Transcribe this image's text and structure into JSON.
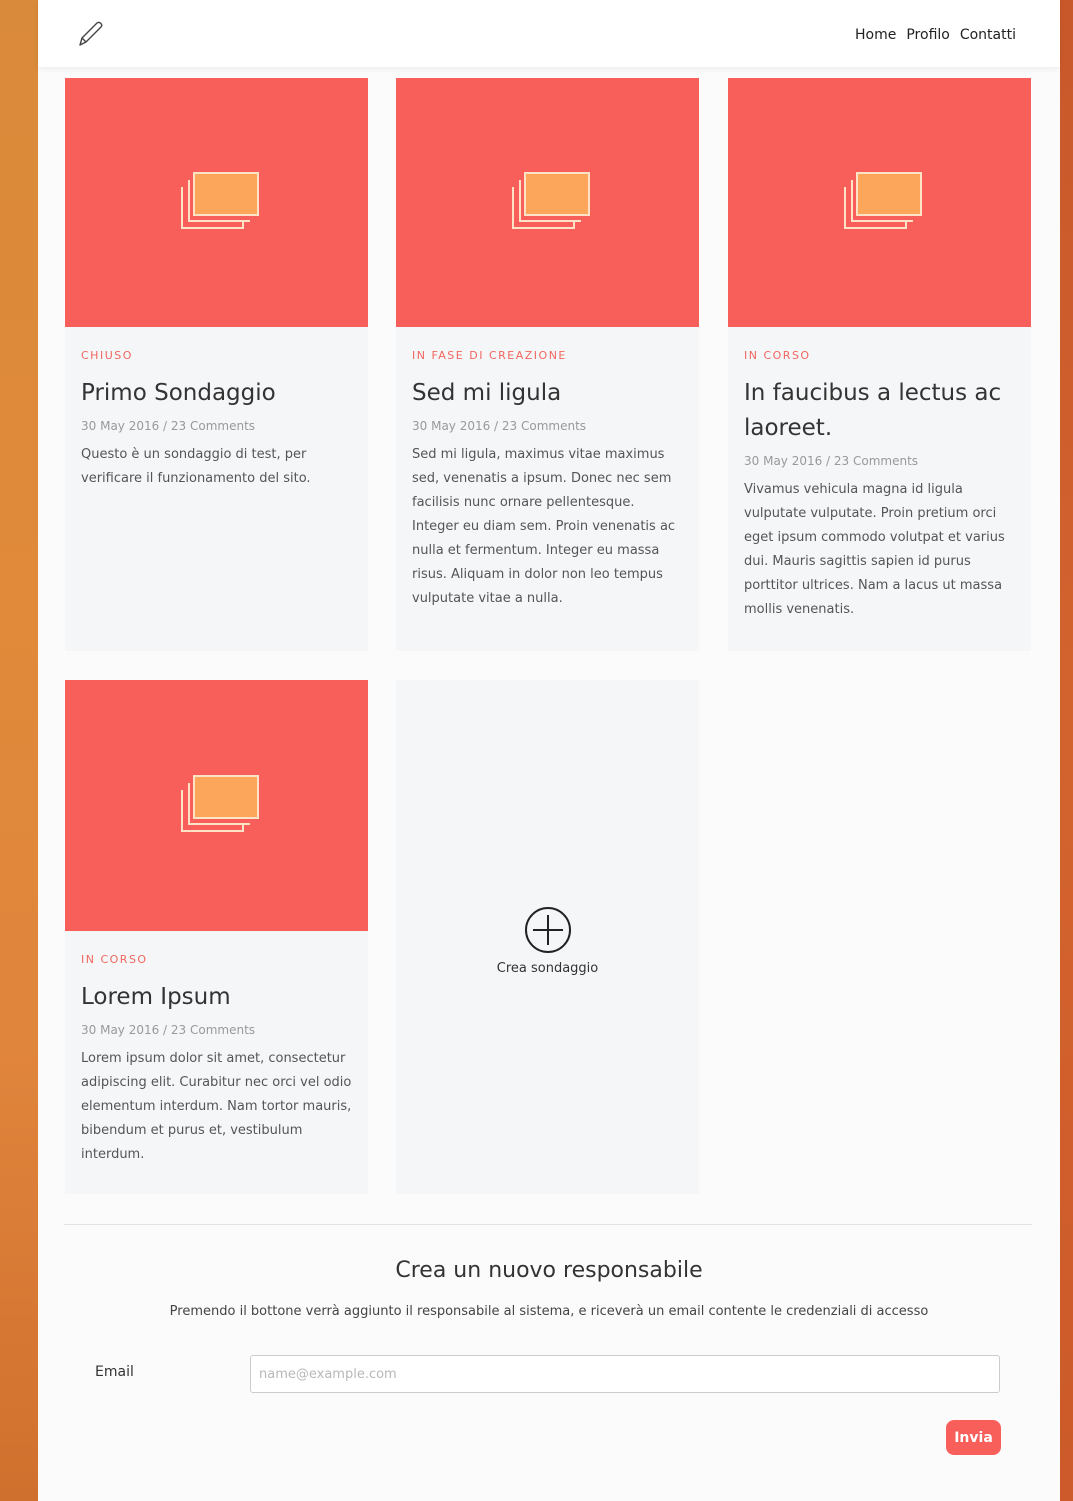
{
  "nav": {
    "logo_icon": "pencil-icon",
    "links": [
      "Home",
      "Profilo",
      "Contatti"
    ]
  },
  "colors": {
    "accent": "#f95f5a",
    "image_icon": "#fba65a"
  },
  "cards": [
    {
      "status": "CHIUSO",
      "title": "Primo Sondaggio",
      "meta": "30 May 2016 / 23 Comments",
      "description": "Questo è un sondaggio di test, per verificare il funzionamento del sito."
    },
    {
      "status": "IN FASE DI CREAZIONE",
      "title": "Sed mi ligula",
      "meta": "30 May 2016 / 23 Comments",
      "description": "Sed mi ligula, maximus vitae maximus sed, venenatis a ipsum. Donec nec sem facilisis nunc ornare pellentesque. Integer eu diam sem. Proin venenatis ac nulla et fermentum. Integer eu massa risus. Aliquam in dolor non leo tempus vulputate vitae a nulla."
    },
    {
      "status": "IN CORSO",
      "title": "In faucibus a lectus ac laoreet.",
      "meta": "30 May 2016 / 23 Comments",
      "description": "Vivamus vehicula magna id ligula vulputate vulputate. Proin pretium orci eget ipsum commodo volutpat et varius dui. Mauris sagittis sapien id purus porttitor ultrices. Nam a lacus ut massa mollis venenatis."
    },
    {
      "status": "IN CORSO",
      "title": "Lorem Ipsum",
      "meta": "30 May 2016 / 23 Comments",
      "description": "Lorem ipsum dolor sit amet, consectetur adipiscing elit. Curabitur nec orci vel odio elementum interdum. Nam tortor mauris, bibendum et purus et, vestibulum interdum."
    }
  ],
  "create_card": {
    "label": "Crea sondaggio",
    "icon": "plus-circle-icon"
  },
  "form": {
    "title": "Crea un nuovo responsabile",
    "subtitle": "Premendo il bottone verrà aggiunto il responsabile al sistema, e riceverà un email contente le credenziali di accesso",
    "email_label": "Email",
    "email_placeholder": "name@example.com",
    "email_value": "",
    "submit_label": "Invia"
  }
}
